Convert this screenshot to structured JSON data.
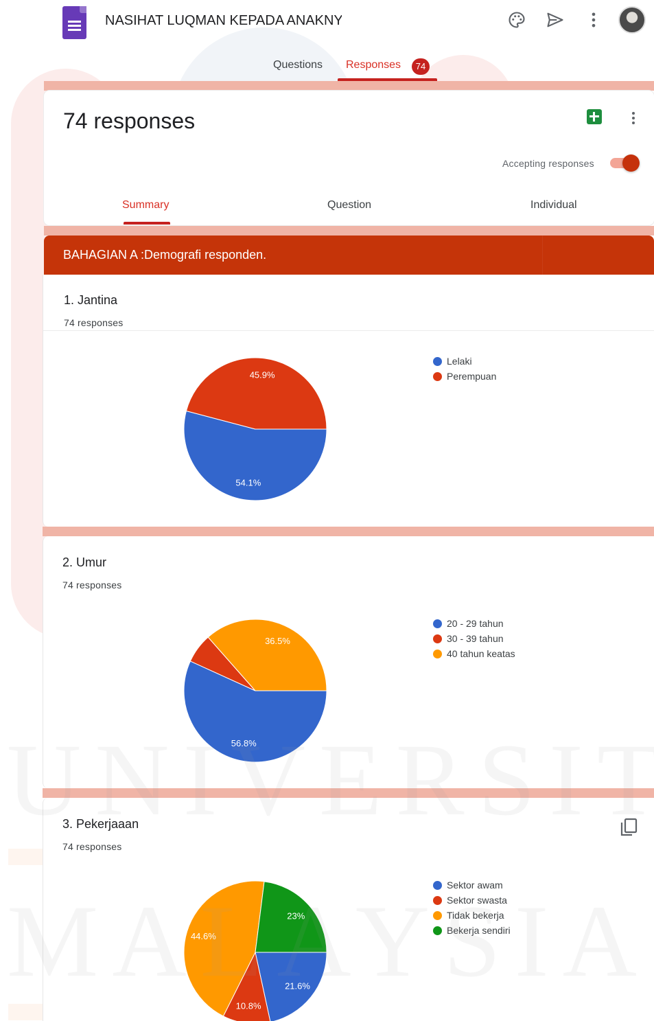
{
  "header": {
    "form_title": "NASIHAT LUQMAN KEPADA ANAKNYA",
    "icons": [
      "palette-icon",
      "send-icon",
      "more-vert-icon",
      "account-avatar"
    ],
    "tabs": [
      {
        "label": "Questions"
      },
      {
        "label": "Responses",
        "badge": "74"
      }
    ],
    "active_tab": "Responses"
  },
  "responses_card": {
    "count_label": "74 responses",
    "accepting_label": "Accepting responses",
    "accepting": true,
    "subtabs": [
      {
        "label": "Summary"
      },
      {
        "label": "Question"
      },
      {
        "label": "Individual"
      }
    ],
    "active_subtab": "Summary"
  },
  "section": {
    "title": "BAHAGIAN A :Demografi responden."
  },
  "questions": [
    {
      "title": "1. Jantina",
      "count": "74 responses"
    },
    {
      "title": "2. Umur",
      "count": "74 responses"
    },
    {
      "title": "3. Pekerjaaan",
      "count": "74 responses"
    }
  ],
  "chart_data": [
    {
      "type": "pie",
      "categories": [
        "Lelaki",
        "Perempuan"
      ],
      "values": [
        54.1,
        45.9
      ],
      "labels": [
        "54.1%",
        "45.9%"
      ],
      "colors": [
        "#3366cc",
        "#dc3912"
      ],
      "legend_position": "right"
    },
    {
      "type": "pie",
      "categories": [
        "20 - 29 tahun",
        "30 - 39 tahun",
        "40 tahun keatas"
      ],
      "values": [
        56.8,
        6.7,
        36.5
      ],
      "labels": [
        "56.8%",
        "",
        "36.5%"
      ],
      "colors": [
        "#3366cc",
        "#dc3912",
        "#ff9900"
      ],
      "legend_position": "right"
    },
    {
      "type": "pie",
      "categories": [
        "Sektor awam",
        "Sektor swasta",
        "Tidak bekerja",
        "Bekerja sendiri"
      ],
      "values": [
        21.6,
        10.8,
        44.6,
        23
      ],
      "labels": [
        "21.6%",
        "10.8%",
        "44.6%",
        "23%"
      ],
      "colors": [
        "#3366cc",
        "#dc3912",
        "#ff9900",
        "#109618"
      ],
      "legend_position": "right"
    }
  ],
  "watermark": {
    "line1": "UNIVERSITI",
    "line2": "MALAYSIA"
  }
}
